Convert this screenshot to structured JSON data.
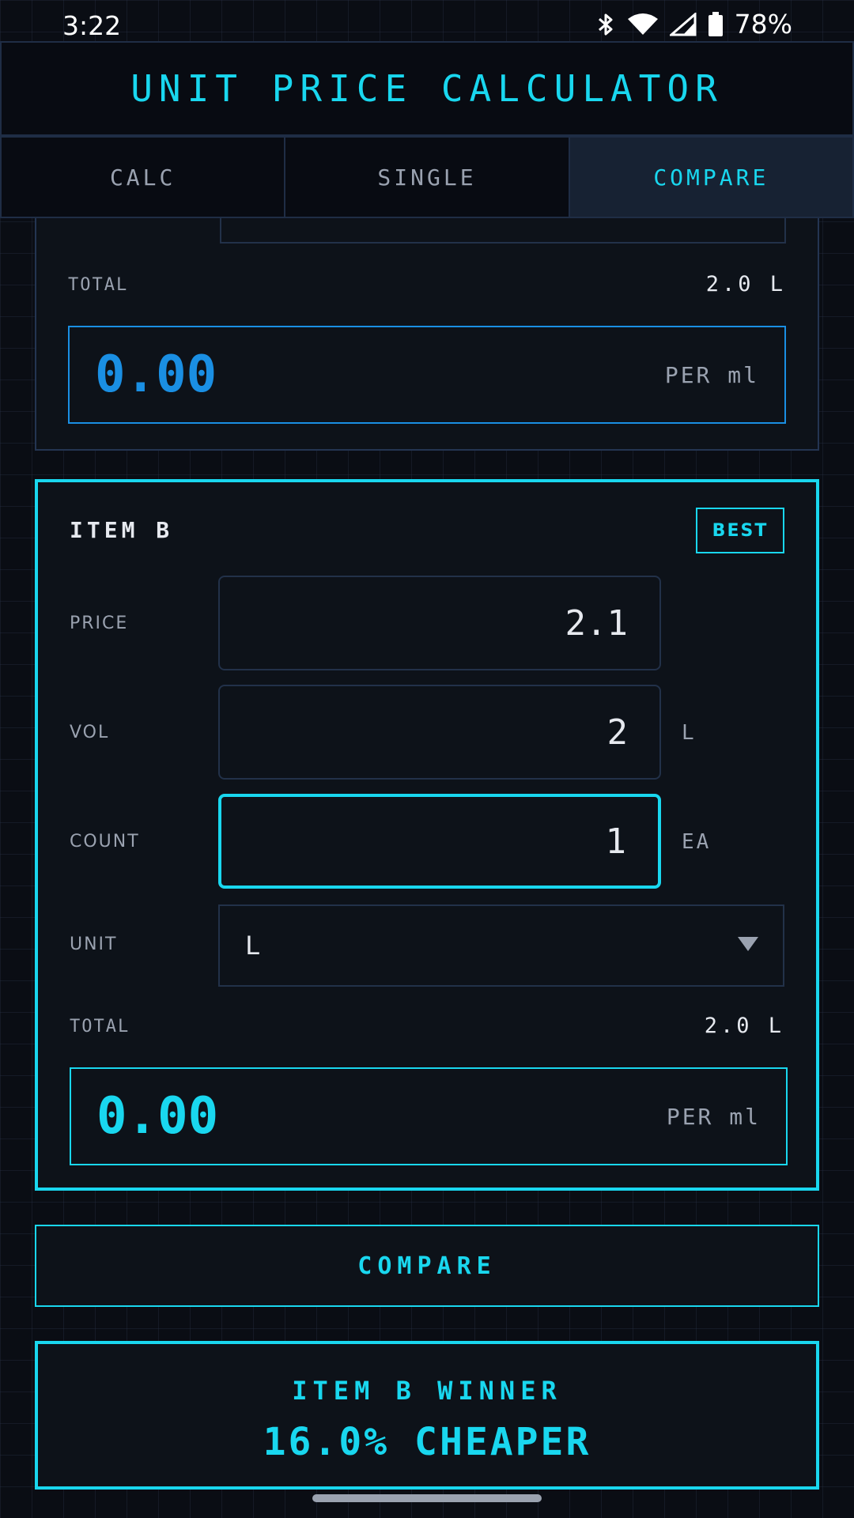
{
  "status_bar": {
    "time": "3:22",
    "battery": "78%",
    "icons": [
      "bluetooth-icon",
      "wifi-icon",
      "signal-icon",
      "battery-icon"
    ]
  },
  "header": {
    "title": "UNIT PRICE CALCULATOR"
  },
  "tabs": [
    {
      "label": "CALC",
      "active": false
    },
    {
      "label": "SINGLE",
      "active": false
    },
    {
      "label": "COMPARE",
      "active": true
    }
  ],
  "item_a": {
    "total_label": "TOTAL",
    "total_value": "2.0 L",
    "result_value": "0.00",
    "result_unit": "PER ml"
  },
  "item_b": {
    "title": "ITEM B",
    "badge": "BEST",
    "price": {
      "label": "PRICE",
      "value": "2.1"
    },
    "vol": {
      "label": "VOL",
      "value": "2",
      "suffix": "L"
    },
    "count": {
      "label": "COUNT",
      "value": "1",
      "suffix": "EA"
    },
    "unit": {
      "label": "UNIT",
      "selected": "L"
    },
    "total_label": "TOTAL",
    "total_value": "2.0 L",
    "result_value": "0.00",
    "result_unit": "PER ml"
  },
  "compare_button": {
    "label": "COMPARE"
  },
  "winner": {
    "title": "ITEM B WINNER",
    "detail": "16.0% CHEAPER"
  },
  "colors": {
    "accent": "#19d7ef",
    "accent_blue": "#1a8fe3",
    "background": "#0a0d14",
    "panel": "#0d1219",
    "muted_text": "#9aa2b0"
  }
}
